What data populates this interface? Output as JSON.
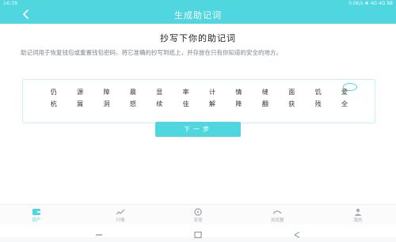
{
  "status": {
    "time": "16:39",
    "right": "0.0K/s ✱ 4G 4G 88"
  },
  "header": {
    "title": "生成助记词"
  },
  "main": {
    "heading": "抄写下你的助记词",
    "description": "助记词用于恢复钱包或重置钱包密码，将它准确的抄写到纸上，并存放在只有你知道的安全的地方。",
    "words": [
      "仍",
      "源",
      "障",
      "晨",
      "显",
      "率",
      "计",
      "情",
      "缝",
      "面",
      "饥",
      "爱",
      "杭",
      "屑",
      "洞",
      "怒",
      "续",
      "佳",
      "解",
      "降",
      "翻",
      "获",
      "残",
      "全"
    ],
    "next_label": "下一步"
  },
  "tabs": [
    {
      "label": "资产",
      "icon": "wallet-icon",
      "active": true
    },
    {
      "label": "行情",
      "icon": "market-icon",
      "active": false
    },
    {
      "label": "发现",
      "icon": "discover-icon",
      "active": false
    },
    {
      "label": "浏览器",
      "icon": "browser-icon",
      "active": false
    },
    {
      "label": "我的",
      "icon": "profile-icon",
      "active": false
    }
  ],
  "colors": {
    "accent": "#4fd6df",
    "text": "#222222",
    "muted": "#7d8590"
  }
}
